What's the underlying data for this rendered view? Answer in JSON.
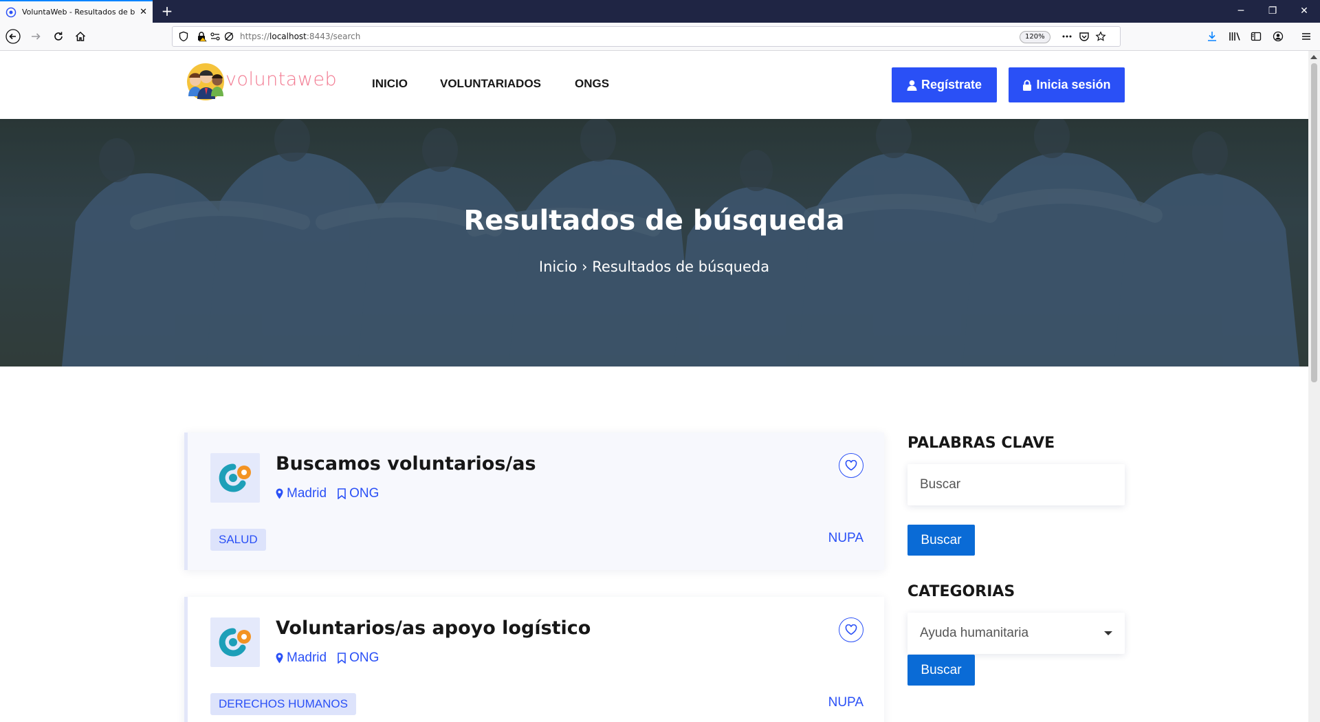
{
  "browser": {
    "tab_title": "VoluntaWeb - Resultados de bú",
    "tab_close": "✕",
    "new_tab": "+",
    "url_scheme": "https://",
    "url_host": "localhost",
    "url_rest": ":8443/search",
    "zoom": "120%",
    "window_controls": {
      "minimize": "─",
      "restore": "❐",
      "close": "✕"
    }
  },
  "header": {
    "logo_text": "voluntaweb",
    "nav": [
      {
        "label": "INICIO"
      },
      {
        "label": "VOLUNTARIADOS"
      },
      {
        "label": "ONGS"
      }
    ],
    "register_label": "Regístrate",
    "login_label": "Inicia sesión"
  },
  "hero": {
    "title": "Resultados de búsqueda",
    "breadcrumb_home": "Inicio",
    "breadcrumb_sep": "›",
    "breadcrumb_current": "Resultados de búsqueda"
  },
  "results": [
    {
      "title": "Buscamos voluntarios/as",
      "location": "Madrid",
      "type": "ONG",
      "category": "SALUD",
      "org": "NUPA"
    },
    {
      "title": "Voluntarios/as apoyo logístico",
      "location": "Madrid",
      "type": "ONG",
      "category": "DERECHOS HUMANOS",
      "org": "NUPA"
    }
  ],
  "sidebar": {
    "keywords_heading": "PALABRAS CLAVE",
    "keywords_placeholder": "Buscar",
    "keywords_button": "Buscar",
    "categories_heading": "CATEGORIAS",
    "categories_selected": "Ayuda humanitaria",
    "categories_button": "Buscar"
  },
  "colors": {
    "primary": "#2a50f6",
    "button_sidebar": "#0a6bd6",
    "tab_bar": "#1f2544",
    "logo_pink": "#f27a91"
  },
  "icons": {
    "location": "map-pin-icon",
    "type": "bookmark-icon",
    "favorite": "heart-icon",
    "register": "user-icon",
    "login": "lock-icon"
  }
}
